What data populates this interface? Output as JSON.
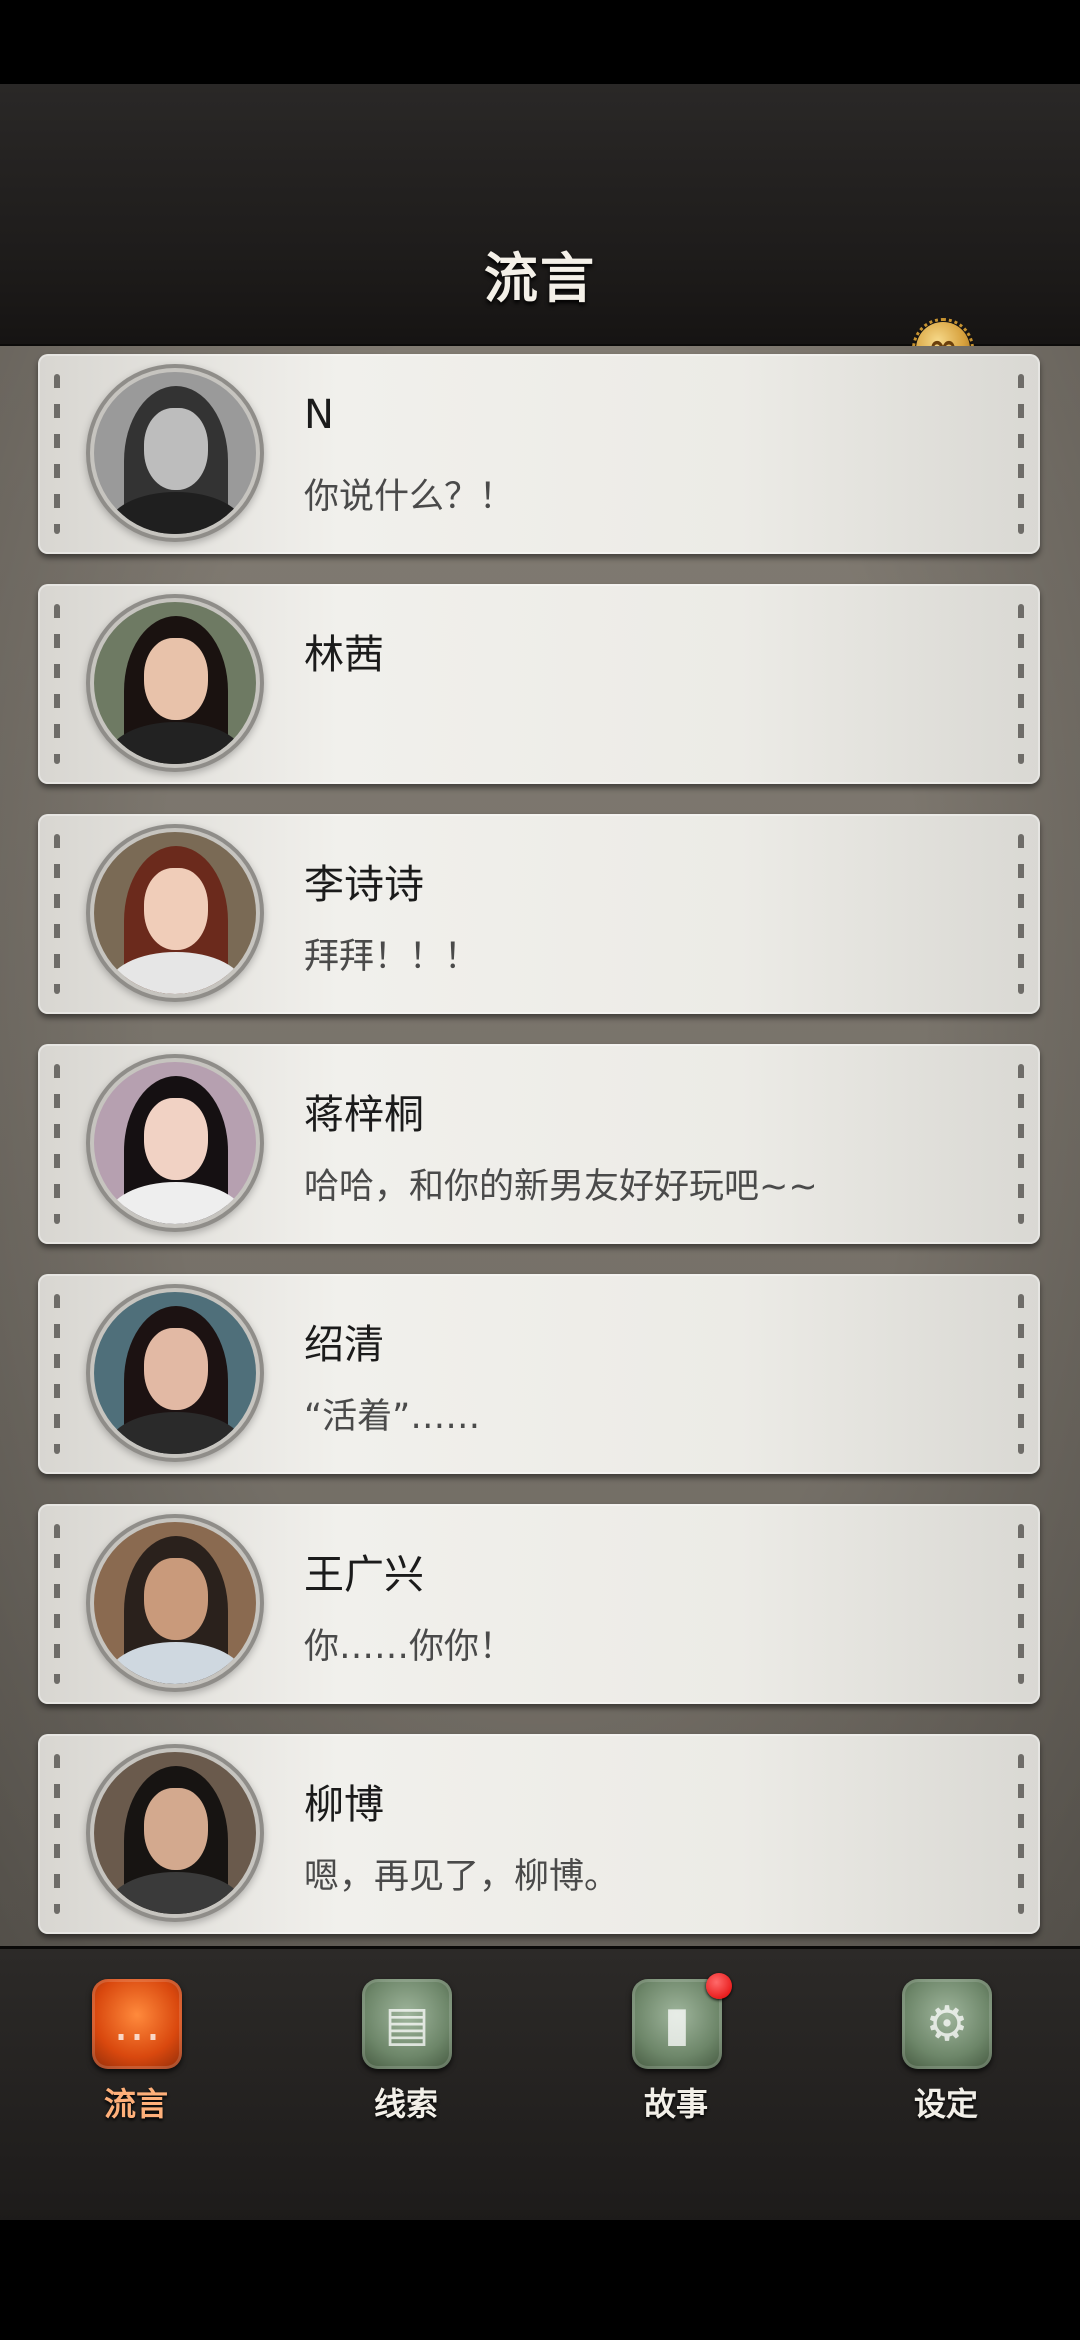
{
  "header": {
    "title": "流言",
    "coin_icon": "infinity-coin-icon",
    "coin_symbol": "∞"
  },
  "chats": [
    {
      "name": "N",
      "message": "你说什么？！",
      "avatar": "avatar-n",
      "tone": "#2b2b2b"
    },
    {
      "name": "林茜",
      "message": "",
      "avatar": "avatar-linxi",
      "tone": "#1e1410"
    },
    {
      "name": "李诗诗",
      "message": "拜拜！！！",
      "avatar": "avatar-lishishi",
      "tone": "#6b2a1c"
    },
    {
      "name": "蒋梓桐",
      "message": "哈哈，和你的新男友好好玩吧~~",
      "avatar": "avatar-jiangzitong",
      "tone": "#151012"
    },
    {
      "name": "绍清",
      "message": "“活着”……",
      "avatar": "avatar-shaoqing",
      "tone": "#1c1212"
    },
    {
      "name": "王广兴",
      "message": "你……你你！",
      "avatar": "avatar-wangguangxing",
      "tone": "#2a211c"
    },
    {
      "name": "柳博",
      "message": "嗯，再见了，柳博。",
      "avatar": "avatar-liubo",
      "tone": "#171412"
    }
  ],
  "tabs": [
    {
      "label": "流言",
      "icon": "chat-bubble-icon",
      "glyph": "…",
      "active": true,
      "badge": false
    },
    {
      "label": "线索",
      "icon": "note-icon",
      "glyph": "▤",
      "active": false,
      "badge": false
    },
    {
      "label": "故事",
      "icon": "book-icon",
      "glyph": "▮",
      "active": false,
      "badge": true
    },
    {
      "label": "设定",
      "icon": "gear-icon",
      "glyph": "⚙",
      "active": false,
      "badge": false
    }
  ],
  "colors": {
    "active_tab": "#d9480e",
    "idle_tab": "#6d8669",
    "badge": "#e00000"
  }
}
